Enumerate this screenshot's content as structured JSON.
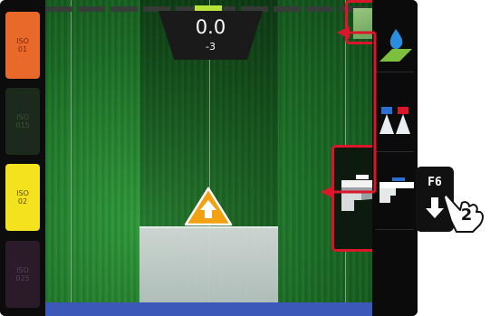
{
  "left_buttons": [
    {
      "line1": "ISO",
      "line2": "01"
    },
    {
      "line1": "ISO",
      "line2": "015"
    },
    {
      "line1": "ISO",
      "line2": "02"
    },
    {
      "line1": "ISO",
      "line2": "025"
    }
  ],
  "readout": {
    "value": "0.0",
    "offset": "-3"
  },
  "right_icons": [
    "water-drop-field-icon",
    "nozzle-pair-icon",
    "boom-section-icon"
  ],
  "highlighted_icons": [
    "field-thumbnail-icon",
    "boom-section-large-icon"
  ],
  "key": {
    "label": "F6"
  },
  "callout": {
    "step": "2"
  },
  "colors": {
    "iso_01": "#e9692a",
    "iso_02": "#f4e21e",
    "highlight": "#d9162a",
    "bottom_bar": "#3c58b8",
    "warning": "#f2a112"
  }
}
